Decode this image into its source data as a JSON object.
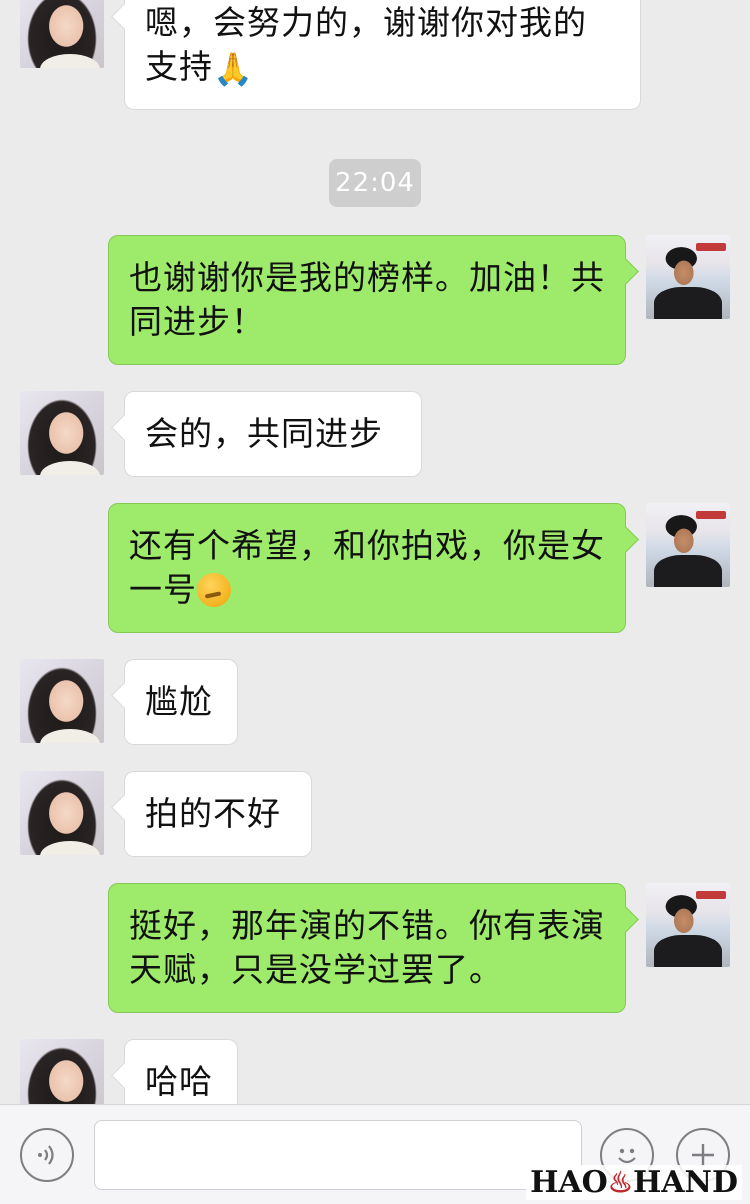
{
  "messages": [
    {
      "side": "left",
      "text": "嗯，会努力的，谢谢你对我的支持",
      "emoji": "🙏"
    },
    {
      "type": "time",
      "text": "22:04"
    },
    {
      "side": "right",
      "text": "也谢谢你是我的榜样。加油！共同进步！"
    },
    {
      "side": "left",
      "text": "会的，共同进步"
    },
    {
      "side": "right",
      "text": "还有个希望，和你拍戏，你是女一号",
      "emoji": "thinking-face"
    },
    {
      "side": "left",
      "text": "尴尬"
    },
    {
      "side": "left",
      "text": "拍的不好"
    },
    {
      "side": "right",
      "text": "挺好，那年演的不错。你有表演天赋，只是没学过罢了。"
    },
    {
      "side": "left",
      "text": "哈哈"
    }
  ],
  "input": {
    "value": "",
    "voice_icon": "voice-icon",
    "emoji_icon": "emoji-icon",
    "plus_icon": "plus-icon"
  },
  "watermark": {
    "left": "HAO",
    "right": "HAND"
  }
}
